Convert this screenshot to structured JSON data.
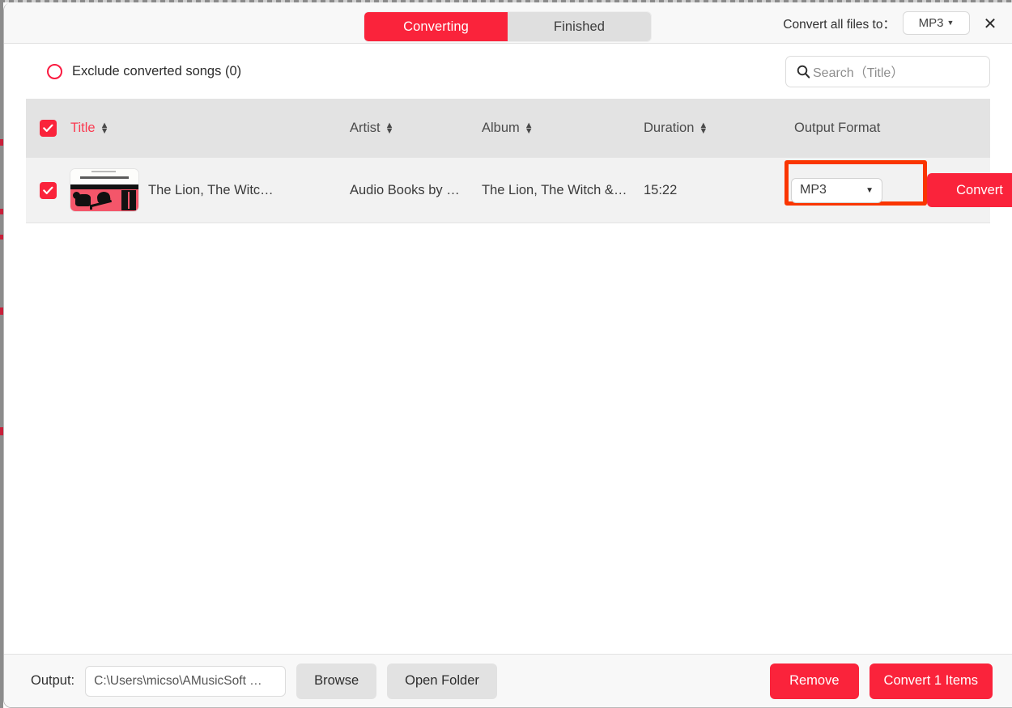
{
  "window": {
    "close_icon": "close-icon"
  },
  "header": {
    "tabs": [
      {
        "label": "Converting",
        "active": true
      },
      {
        "label": "Finished",
        "active": false
      }
    ],
    "convert_all_label": "Convert all files to：",
    "convert_all_format": "MP3",
    "caret": "▾",
    "close": "✕"
  },
  "filters": {
    "exclude_label": "Exclude converted songs (0)",
    "exclude_checked": false,
    "search": {
      "placeholder": "Search（Title）",
      "value": "",
      "icon": "search-icon"
    }
  },
  "table": {
    "select_all_checked": true,
    "columns": [
      {
        "key": "title",
        "label": "Title",
        "sortable": true,
        "sorted": true
      },
      {
        "key": "artist",
        "label": "Artist",
        "sortable": true,
        "sorted": false
      },
      {
        "key": "album",
        "label": "Album",
        "sortable": true,
        "sorted": false
      },
      {
        "key": "duration",
        "label": "Duration",
        "sortable": true,
        "sorted": false
      },
      {
        "key": "output_format",
        "label": "Output Format",
        "sortable": false,
        "sorted": false
      }
    ],
    "sort_arrows": "⬍",
    "rows": [
      {
        "checked": true,
        "artwork": "album-art-lion-witch-wardrobe",
        "title": "The Lion, The Witc…",
        "artist": "Audio Books by …",
        "album": "The Lion, The Witch &…",
        "duration": "15:22",
        "output_format": "MP3",
        "convert_label": "Convert",
        "remove_icon": "✕"
      }
    ]
  },
  "annotation": {
    "target": "output-format-select",
    "color": "#FA3500"
  },
  "footer": {
    "output_label": "Output:",
    "output_path": "C:\\Users\\micso\\AMusicSoft …",
    "browse_label": "Browse",
    "open_folder_label": "Open Folder",
    "remove_label": "Remove",
    "convert_items_label": "Convert 1 Items"
  },
  "colors": {
    "accent_red": "#FA233B",
    "annotation_orange": "#FA3500",
    "tab_inactive": "#DFDFDF",
    "table_header": "#E3E3E3",
    "row_bg": "#F2F2F2"
  }
}
